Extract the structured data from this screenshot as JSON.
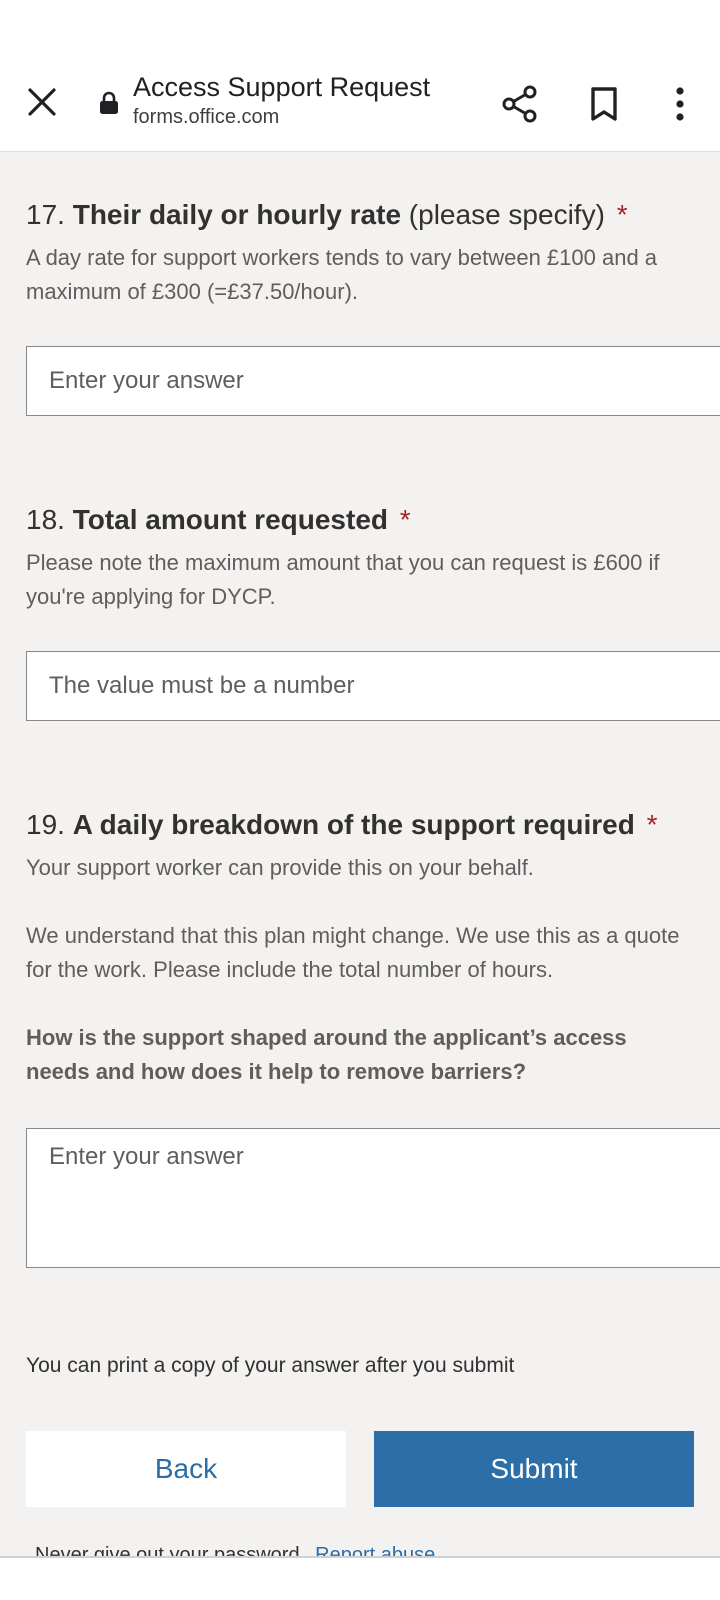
{
  "browser": {
    "title": "Access Support Request",
    "url": "forms.office.com",
    "icons": {
      "close": "close-icon",
      "lock": "lock-icon",
      "share": "share-icon",
      "bookmark": "bookmark-icon",
      "menu": "more-vert-icon"
    }
  },
  "questions": [
    {
      "number": "17.",
      "title": "Their daily or hourly rate",
      "title_suffix": " (please specify)",
      "required_mark": "*",
      "description": "A day rate for support workers tends to vary between £100 and a maximum of £300 (=£37.50/hour).",
      "placeholder": "Enter your answer"
    },
    {
      "number": "18.",
      "title": "Total amount requested",
      "required_mark": "*",
      "description": "Please note the maximum amount that you can request is £600 if you're applying for DYCP.",
      "placeholder": "The value must be a number"
    },
    {
      "number": "19.",
      "title": "A daily breakdown of the support required",
      "required_mark": "*",
      "description": "Your support worker can provide this on your behalf.",
      "description_2": "We understand that this plan might change. We use this as a quote for the work. Please include the total number of hours.",
      "description_bold": "How is the support shaped around the applicant’s access needs and how does it help to remove barriers?",
      "placeholder": "Enter your answer"
    }
  ],
  "print_note": "You can print a copy of your answer after you submit",
  "buttons": {
    "back": "Back",
    "submit": "Submit"
  },
  "footer": {
    "text": "Never give out your password.",
    "link": "Report abuse"
  },
  "colors": {
    "required": "#a4262c",
    "accent": "#2b6ea8",
    "background": "#f3f2f1"
  }
}
